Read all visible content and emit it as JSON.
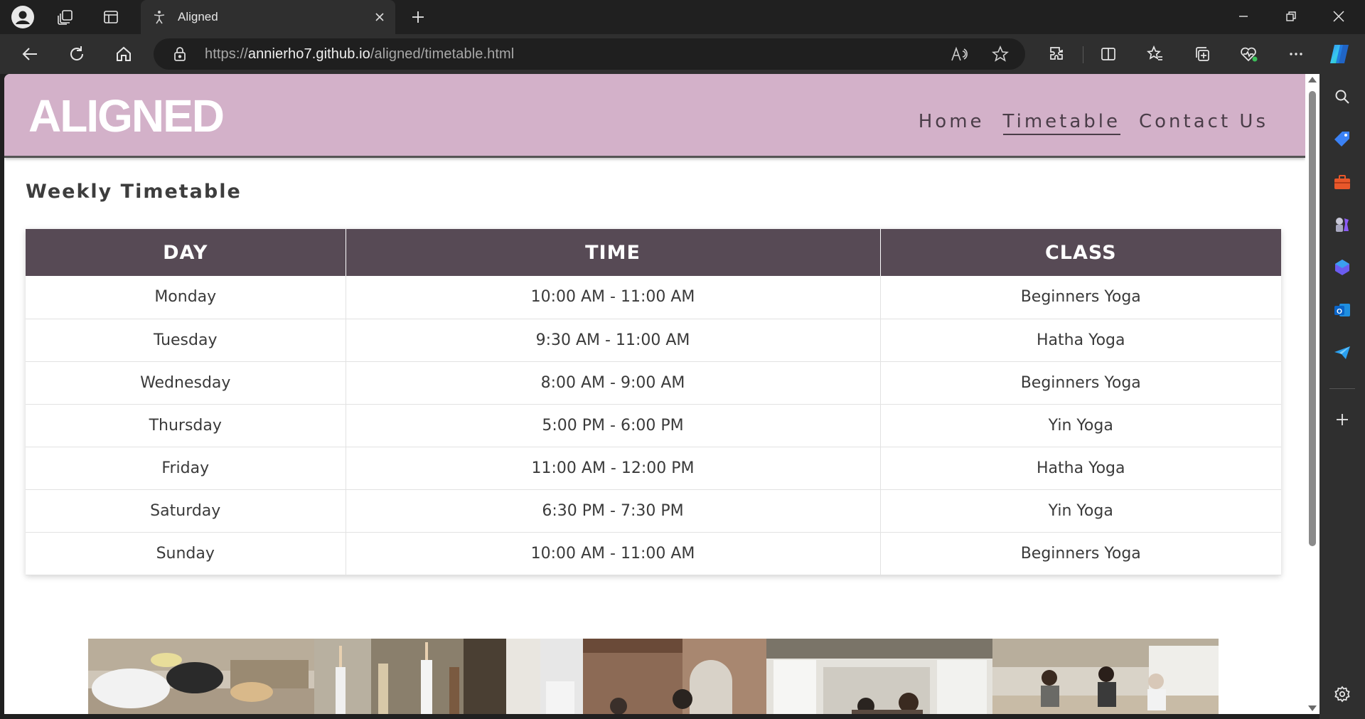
{
  "browser": {
    "tab_title": "Aligned",
    "url_prefix": "https://",
    "url_host": "annierho7.github.io",
    "url_path": "/aligned/timetable.html"
  },
  "site": {
    "logo": "ALIGNED",
    "nav": [
      {
        "label": "Home",
        "active": false
      },
      {
        "label": "Timetable",
        "active": true
      },
      {
        "label": "Contact Us",
        "active": false
      }
    ],
    "accent_color": "#d3b1c9",
    "header_text_color": "#574a55"
  },
  "timetable": {
    "title": "Weekly Timetable",
    "headers": [
      "DAY",
      "TIME",
      "CLASS"
    ],
    "rows": [
      {
        "day": "Monday",
        "time": "10:00 AM - 11:00 AM",
        "class": "Beginners Yoga"
      },
      {
        "day": "Tuesday",
        "time": "9:30 AM - 11:00 AM",
        "class": "Hatha Yoga"
      },
      {
        "day": "Wednesday",
        "time": "8:00 AM - 9:00 AM",
        "class": "Beginners Yoga"
      },
      {
        "day": "Thursday",
        "time": "5:00 PM - 6:00 PM",
        "class": "Yin Yoga"
      },
      {
        "day": "Friday",
        "time": "11:00 AM - 12:00 PM",
        "class": "Hatha Yoga"
      },
      {
        "day": "Saturday",
        "time": "6:30 PM - 7:30 PM",
        "class": "Yin Yoga"
      },
      {
        "day": "Sunday",
        "time": "10:00 AM - 11:00 AM",
        "class": "Beginners Yoga"
      }
    ]
  },
  "gallery": {
    "photos": [
      "yoga-child-pose-photo",
      "yoga-studio-arms-raised-photo",
      "brick-studio-class-photo",
      "bright-studio-class-photo",
      "seated-meditation-group-photo"
    ]
  },
  "icons": {
    "profile": "profile-icon",
    "workspaces": "workspaces-icon",
    "tab-actions": "tab-actions-icon",
    "search": "search-icon",
    "shopping": "shopping-tag-icon",
    "tools": "toolbox-icon",
    "games": "chess-icon",
    "copilot": "copilot-icon",
    "outlook": "outlook-icon",
    "drop": "send-icon",
    "settings": "gear-icon"
  }
}
